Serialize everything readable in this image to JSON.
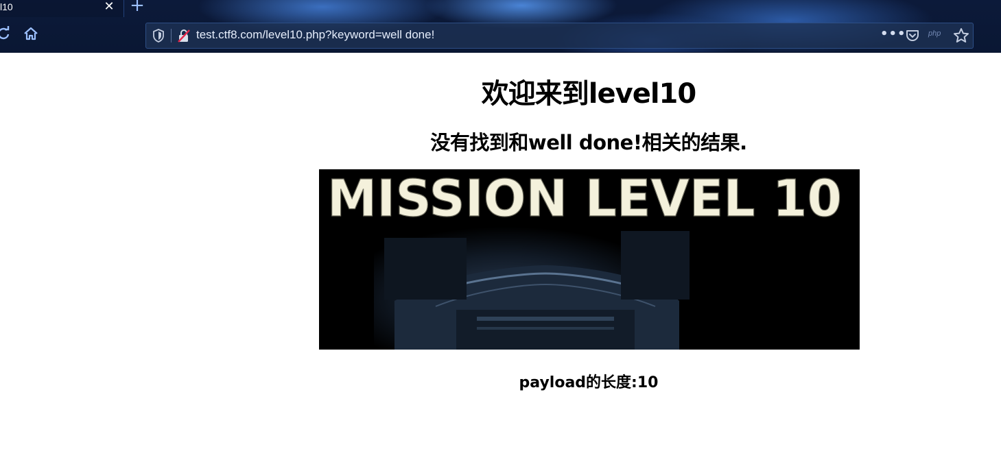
{
  "browser": {
    "tab_title": "l10",
    "tab_close_glyph": "✕",
    "new_tab_glyph": "+",
    "url_host": "test.ctf8.com",
    "url_path": "/level10.php?keyword=well done!",
    "more_glyph": "•••",
    "extension_label": "php"
  },
  "page": {
    "title": "欢迎来到level10",
    "result_text": "没有找到和well done!相关的结果.",
    "banner_text": "MISSION LEVEL 10",
    "payload_length_text": "payload的长度:10"
  },
  "colors": {
    "chrome_bg": "#0c1a3a",
    "url_text": "#e6eefc",
    "page_bg": "#ffffff",
    "banner_text": "#f4f1dc"
  }
}
